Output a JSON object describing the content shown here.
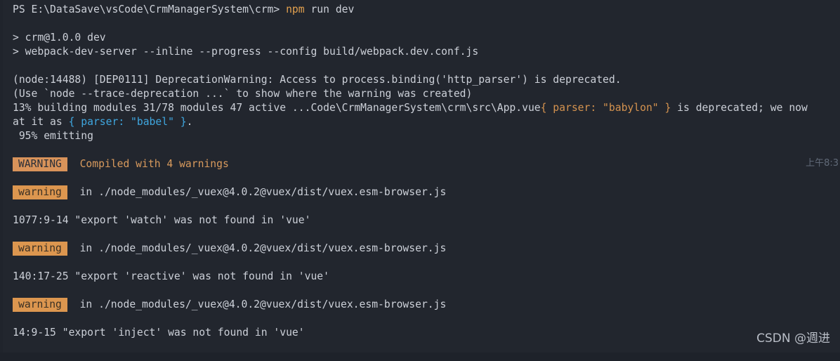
{
  "terminal": {
    "shell": "powershell",
    "background_color": "#22262e",
    "foreground_color": "#ccd0d8",
    "accent_color": "#e3a14f",
    "warning_badge_color": "#d8935a",
    "blue_token_color": "#3fa7e0",
    "orange_token_color": "#d5934f",
    "clipped_top_fragment": "",
    "prompt": {
      "prefix": "PS ",
      "path": "E:\\DataSave\\vsCode\\CrmManagerSystem\\crm",
      "suffix": "> ",
      "command_head": "npm",
      "command_tail": " run dev"
    },
    "lines": {
      "script_name": "> crm@1.0.0 dev",
      "script_cmd": "> webpack-dev-server --inline --progress --config build/webpack.dev.conf.js",
      "dep_warning": "(node:14488) [DEP0111] DeprecationWarning: Access to process.binding('http_parser') is deprecated.",
      "dep_hint": "(Use `node --trace-deprecation ...` to show where the warning was created)",
      "progress_build_a": " 13% building modules 31/78 modules 47 active ...Code\\CrmManagerSystem\\crm\\src\\App.vue",
      "progress_build_babylon": "{ parser: \"babylon\" }",
      "progress_build_b": " is deprecated; we now",
      "at_it_as_prefix": "at it as ",
      "at_it_as_babel": "{ parser: \"babel\" }",
      "at_it_as_suffix": ".",
      "progress_emitting": " 95% emitting",
      "warning_badge": "WARNING",
      "warning_summary": "Compiled with 4 warnings",
      "warning_badge_lower": "warning",
      "module_path": "in ./node_modules/_vuex@4.0.2@vuex/dist/vuex.esm-browser.js",
      "export_watch": "1077:9-14 \"export 'watch' was not found in 'vue'",
      "export_reactive": "140:17-25 \"export 'reactive' was not found in 'vue'",
      "export_inject": "14:9-15 \"export 'inject' was not found in 'vue'"
    },
    "timestamp": "上午8:3",
    "watermark": "CSDN @週进"
  }
}
